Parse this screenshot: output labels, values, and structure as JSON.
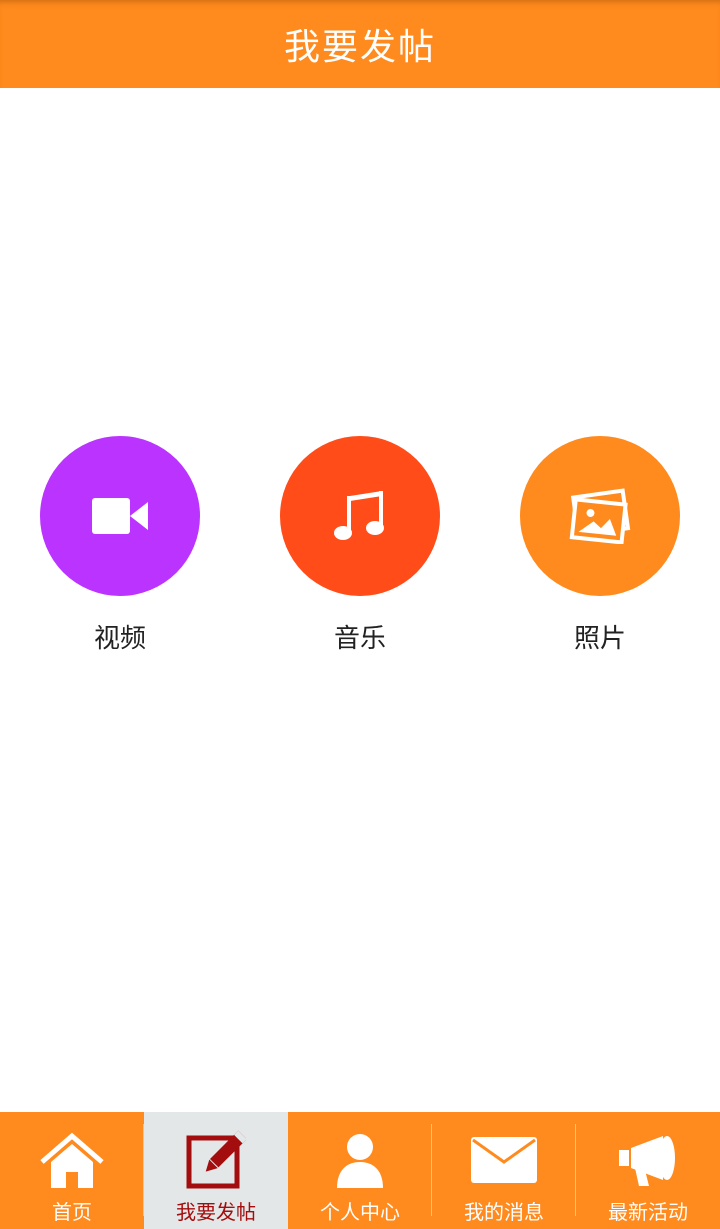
{
  "header": {
    "title": "我要发帖"
  },
  "post_options": [
    {
      "label": "视频",
      "icon": "video-camera-icon",
      "color": "#bb33ff"
    },
    {
      "label": "音乐",
      "icon": "music-note-icon",
      "color": "#ff4c19"
    },
    {
      "label": "照片",
      "icon": "photos-icon",
      "color": "#ff8a1d"
    }
  ],
  "tabbar": {
    "active_index": 1,
    "items": [
      {
        "label": "首页",
        "icon": "home-icon"
      },
      {
        "label": "我要发帖",
        "icon": "edit-icon"
      },
      {
        "label": "个人中心",
        "icon": "user-icon"
      },
      {
        "label": "我的消息",
        "icon": "mail-icon"
      },
      {
        "label": "最新活动",
        "icon": "megaphone-icon"
      }
    ]
  },
  "colors": {
    "brand_orange": "#ff8a1d",
    "active_tab_bg": "#e3e7e8",
    "active_tab_text": "#a30d0d"
  }
}
